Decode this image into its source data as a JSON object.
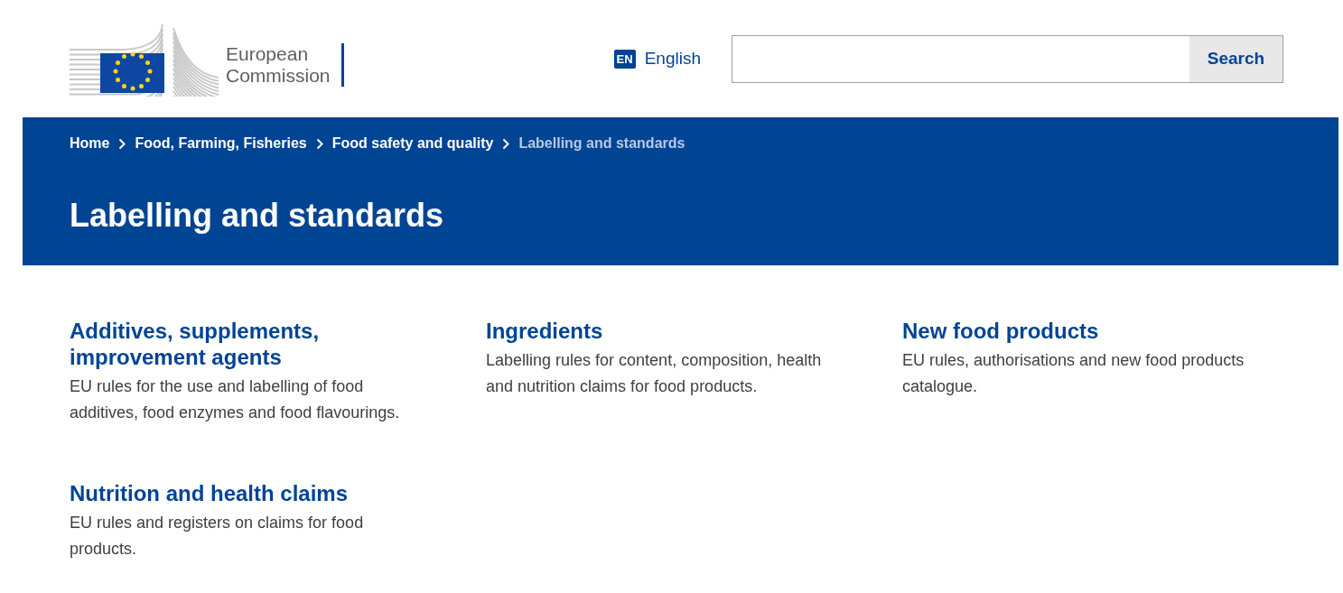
{
  "header": {
    "logo_text": [
      "European",
      "Commission"
    ],
    "language": {
      "code": "EN",
      "label": "English"
    },
    "search": {
      "button": "Search"
    }
  },
  "breadcrumb": [
    {
      "label": "Home",
      "current": false
    },
    {
      "label": "Food, Farming, Fisheries",
      "current": false
    },
    {
      "label": "Food safety and quality",
      "current": false
    },
    {
      "label": "Labelling and standards",
      "current": true
    }
  ],
  "page_title": "Labelling and standards",
  "topics": [
    {
      "title": "Additives, supplements, improvement agents",
      "description": "EU rules for the use and labelling of food additives, food enzymes and food flavourings."
    },
    {
      "title": "Ingredients",
      "description": "Labelling rules for content, composition, health and nutrition claims for food products."
    },
    {
      "title": "New food products",
      "description": "EU rules, authorisations and new food products catalogue."
    },
    {
      "title": "Nutrition and health claims",
      "description": "EU rules and registers on claims for food products."
    }
  ]
}
